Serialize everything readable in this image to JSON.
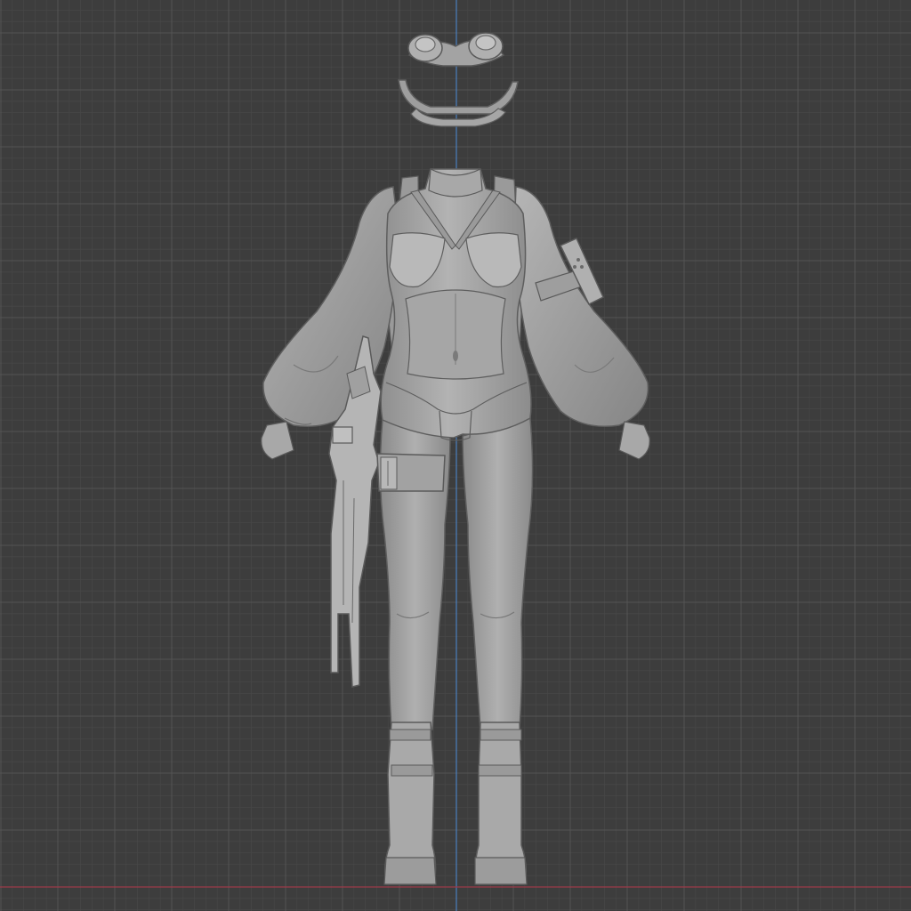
{
  "viewport": {
    "view": "front-orthographic",
    "background_color": "#3d3d3d",
    "grid_minor_color": "#474747",
    "grid_major_color": "#545454",
    "y_axis_color": "#4a7fbf",
    "x_axis_color": "#9c3b4a"
  },
  "model": {
    "objects": [
      {
        "name": "goggles"
      },
      {
        "name": "bodysuit-with-puffed-sleeves"
      },
      {
        "name": "backpack-frame"
      },
      {
        "name": "armband"
      },
      {
        "name": "thigh-strap"
      },
      {
        "name": "rifle"
      },
      {
        "name": "boots"
      }
    ],
    "shading": "solid",
    "mesh_color": "#a9a9a9"
  }
}
